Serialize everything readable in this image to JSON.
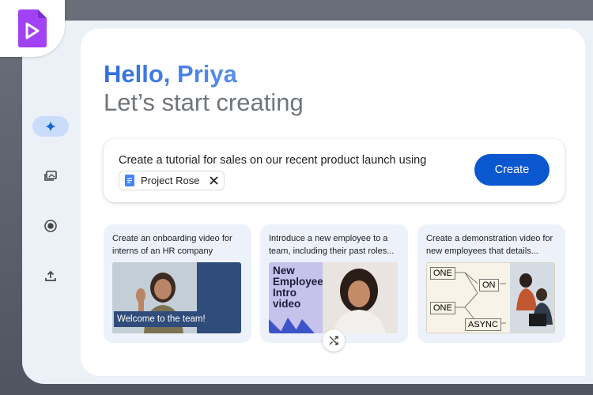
{
  "greeting": {
    "hello": "Hello, Priya",
    "subtitle": "Let’s start creating"
  },
  "sidebar": {
    "items": [
      {
        "icon": "sparkle-icon",
        "active": true
      },
      {
        "icon": "media-library-icon",
        "active": false
      },
      {
        "icon": "record-icon",
        "active": false
      },
      {
        "icon": "upload-icon",
        "active": false
      }
    ]
  },
  "prompt": {
    "text": "Create a tutorial for sales on our recent product launch using",
    "chip_label": "Project Rose",
    "create_label": "Create"
  },
  "templates": [
    {
      "description": "Create an onboarding video for interns of an HR company",
      "thumb_caption": "Welcome to the team!"
    },
    {
      "description": "Introduce a new employee to a team, including their past roles...",
      "thumb_caption": "New Employee Intro video"
    },
    {
      "description": "Create a demonstration video for new employees that details...",
      "diagram_labels": [
        "ONE",
        "ON",
        "ONE",
        "ASYNC"
      ]
    }
  ],
  "colors": {
    "accent": "#0b57d0",
    "logo": "#a142f4",
    "greeting": "#3c7fe6"
  }
}
